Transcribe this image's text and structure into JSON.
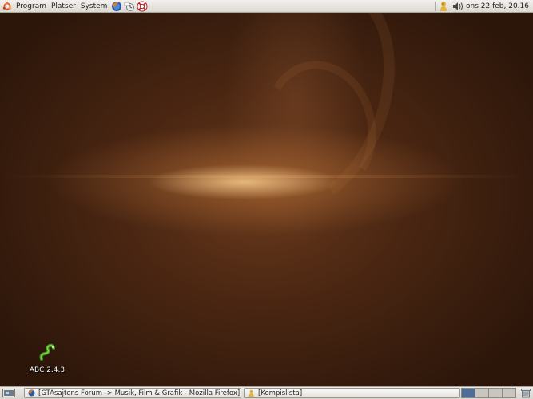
{
  "top_panel": {
    "menus": [
      "Program",
      "Platser",
      "System"
    ],
    "launchers": [
      "firefox-icon",
      "evolution-icon",
      "help-icon"
    ],
    "clock": "ons 22 feb, 20.16"
  },
  "desktop": {
    "icons": [
      {
        "label": "ABC 2.4.3",
        "icon": "snake-icon"
      }
    ]
  },
  "bottom_panel": {
    "tasks": [
      {
        "label": "[GTAsajtens Forum -> Musik, Film & Grafik - Mozilla Firefox]",
        "icon": "firefox-icon"
      },
      {
        "label": "[Kompislista]",
        "icon": "buddy-icon"
      }
    ],
    "workspaces": 4,
    "active_workspace": 1
  },
  "colors": {
    "panel": "#dcd8d2",
    "wallpaper": "#4a2612",
    "workspace_active": "#4e6f95"
  }
}
